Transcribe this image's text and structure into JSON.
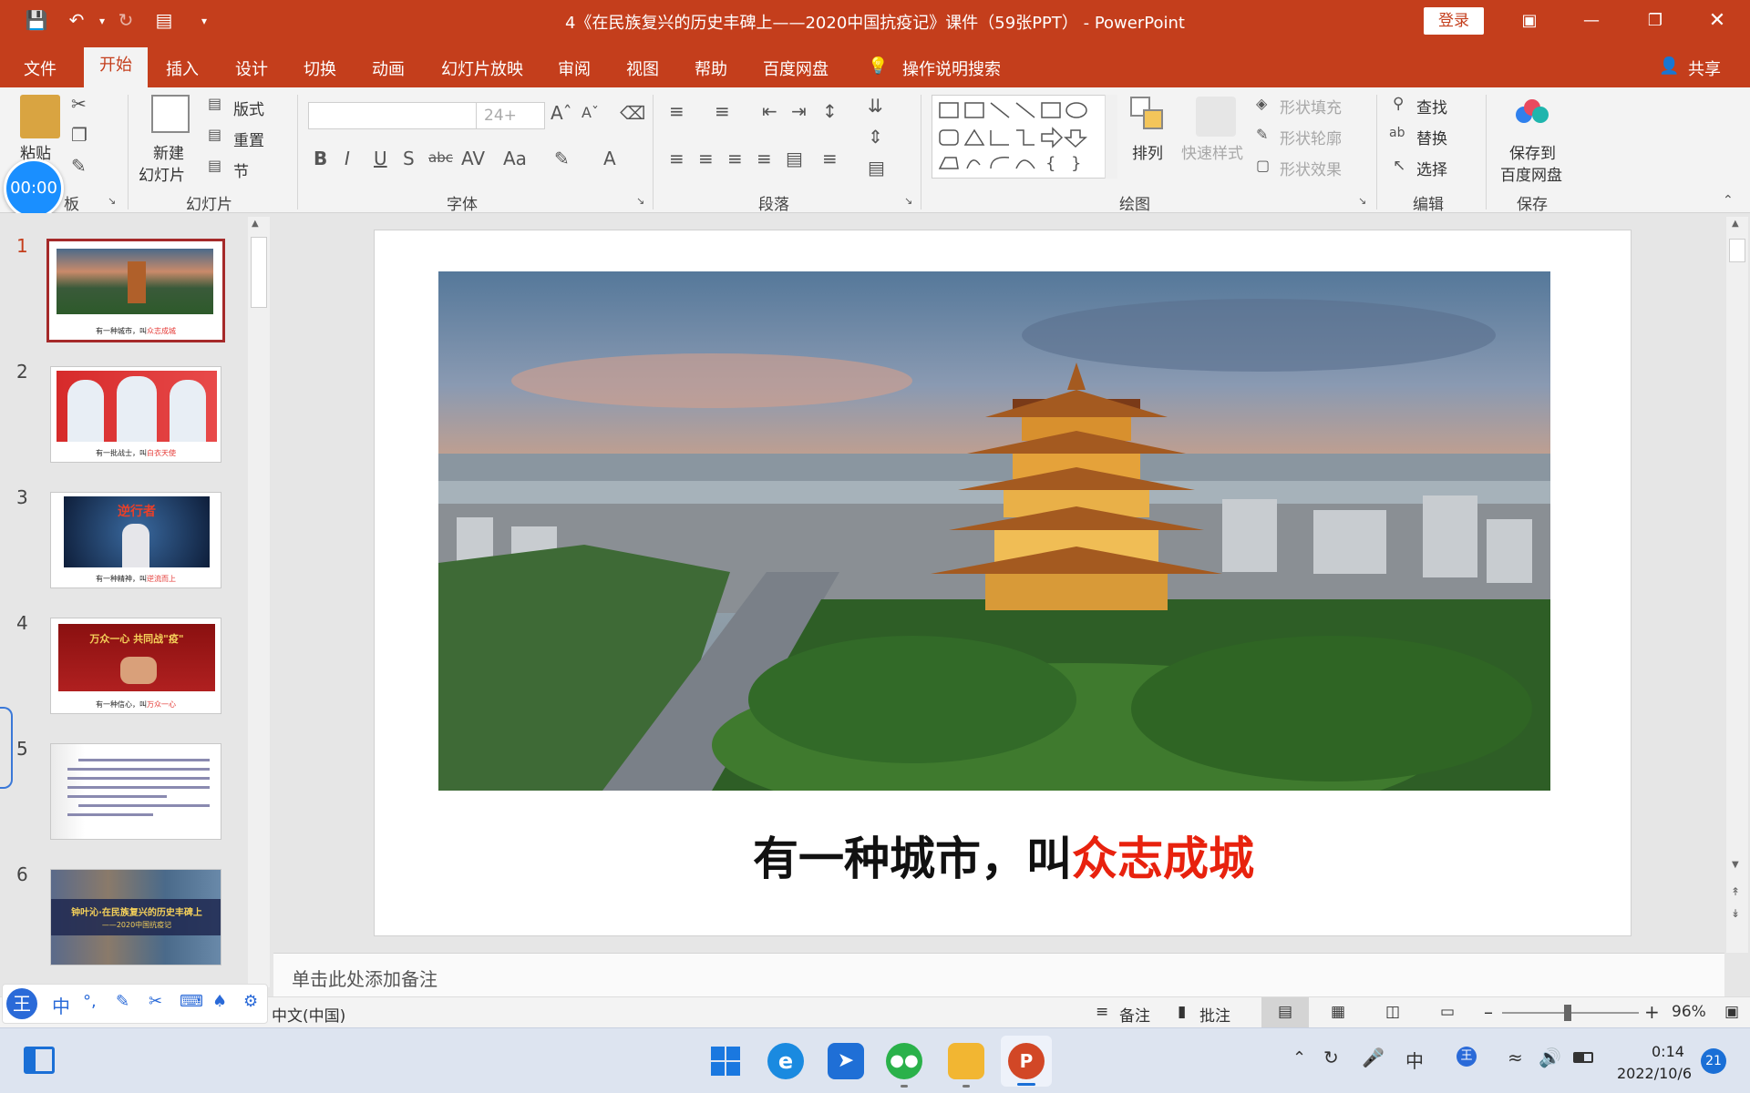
{
  "window": {
    "title": "4《在民族复兴的历史丰碑上——2020中国抗疫记》课件（59张PPT） - PowerPoint",
    "login_label": "登录"
  },
  "menu": {
    "tabs": [
      "文件",
      "开始",
      "插入",
      "设计",
      "切换",
      "动画",
      "幻灯片放映",
      "审阅",
      "视图",
      "帮助",
      "百度网盘"
    ],
    "search_label": "操作说明搜索",
    "share_label": "共享"
  },
  "ribbon": {
    "clipboard": {
      "paste": "粘贴",
      "label": "板"
    },
    "slides": {
      "new_slide_1": "新建",
      "new_slide_2": "幻灯片",
      "layout": "版式",
      "reset": "重置",
      "section": "节",
      "label": "幻灯片"
    },
    "font": {
      "font_size": "24+",
      "label": "字体"
    },
    "paragraph": {
      "label": "段落"
    },
    "drawing": {
      "arrange": "排列",
      "quick_styles": "快速样式",
      "shape_fill": "形状填充",
      "shape_outline": "形状轮廓",
      "shape_effects": "形状效果",
      "label": "绘图"
    },
    "editing": {
      "find": "查找",
      "replace": "替换",
      "select": "选择",
      "label": "编辑"
    },
    "save": {
      "save_to_1": "保存到",
      "save_to_2": "百度网盘",
      "label": "保存"
    }
  },
  "timer": "00:00",
  "thumbnails": [
    {
      "num": "1",
      "caption_black": "有一种城市，叫",
      "caption_red": "众志成城"
    },
    {
      "num": "2",
      "caption_black": "有一批战士，叫",
      "caption_red": "白衣天使"
    },
    {
      "num": "3",
      "caption_black": "有一种精神，叫",
      "caption_red": "逆流而上"
    },
    {
      "num": "4",
      "caption_black": "有一种信心，叫",
      "caption_red": "万众一心"
    },
    {
      "num": "5",
      "caption_black": "",
      "caption_red": ""
    },
    {
      "num": "6",
      "caption_black": "",
      "caption_red": ""
    }
  ],
  "thumb_banners": {
    "t3": "逆行者",
    "t4": "万众一心 共同战\"疫\"",
    "t6": "钟叶沁·在民族复兴的历史丰碑上",
    "t6_sub": "——2020中国抗疫记"
  },
  "slide": {
    "caption_black": "有一种城市，叫",
    "caption_red": "众志成城"
  },
  "notes_placeholder": "单击此处添加备注",
  "status": {
    "language": "中文(中国)",
    "notes": "备注",
    "comments": "批注",
    "zoom": "96%"
  },
  "taskbar": {
    "time": "0:14",
    "date": "2022/10/6",
    "notification_count": "21",
    "ime_lang": "中"
  },
  "colors": {
    "accent": "#c43e1c",
    "caption_red": "#e8220e"
  }
}
